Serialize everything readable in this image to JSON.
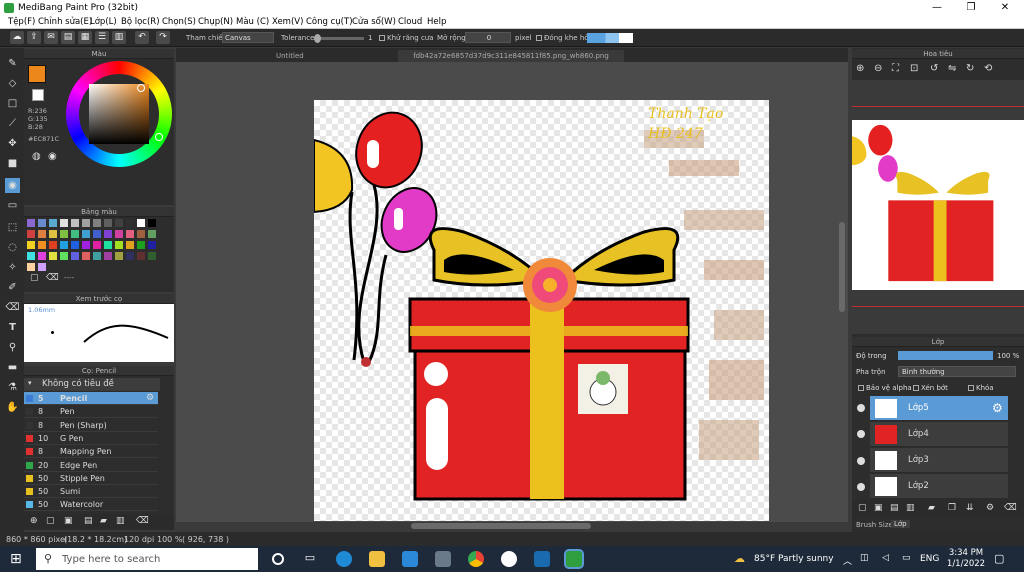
{
  "window": {
    "title": "MediBang Paint Pro (32bit)",
    "minimize": "—",
    "maximize": "❐",
    "close": "✕"
  },
  "menu": [
    "Tệp(F)",
    "Chỉnh sửa(E)",
    "Lớp(L)",
    "Bộ lọc(R)",
    "Chọn(S)",
    "Chụp(N)",
    "Màu (C)",
    "Xem(V)",
    "Công cụ(T)",
    "Cửa sổ(W)",
    "Cloud",
    "Help"
  ],
  "toolbar": {
    "ref_label": "Tham chiếu",
    "ref_value": "Canvas",
    "tolerance_label": "Tolerance",
    "tolerance_value": "1",
    "antialias_label": "Khử răng cưa",
    "expand_label": "Mở rộng",
    "expand_value": "0",
    "expand_unit": "pixel",
    "close_gap_label": "Đóng khe hở"
  },
  "tabs": {
    "untitled": "Untitled",
    "file": "fdb42a72e6857d37d9c311e845811f85.png_wh860.png"
  },
  "color_panel": {
    "title": "Màu",
    "r": "R:236",
    "g": "G:135",
    "b": "B:28",
    "hex": "#EC871C",
    "fg": "#ec871c",
    "bg": "#ffffff"
  },
  "palette_panel": {
    "title": "Bảng màu",
    "more": "----"
  },
  "brush_preview": {
    "title": "Xem trước cọ",
    "size": "1.06mm"
  },
  "brush_panel": {
    "title": "Cọ: Pencil",
    "group": "Không có tiêu đề",
    "brushes": [
      {
        "size": "5",
        "name": "Pencil",
        "color": "#3a7bd5"
      },
      {
        "size": "8",
        "name": "Pen",
        "color": "#333333"
      },
      {
        "size": "8",
        "name": "Pen (Sharp)",
        "color": "#333333"
      },
      {
        "size": "10",
        "name": "G Pen",
        "color": "#e03030"
      },
      {
        "size": "8",
        "name": "Mapping Pen",
        "color": "#e03030"
      },
      {
        "size": "20",
        "name": "Edge Pen",
        "color": "#2ea84a"
      },
      {
        "size": "50",
        "name": "Stipple Pen",
        "color": "#e8c020"
      },
      {
        "size": "50",
        "name": "Sumi",
        "color": "#e8c020"
      },
      {
        "size": "50",
        "name": "Watercolor",
        "color": "#58b8e8"
      }
    ]
  },
  "canvas_text": {
    "signature_line1": "Thanh Tạo",
    "signature_line2": "HĐ 247"
  },
  "navigator": {
    "title": "Hoa tiêu"
  },
  "layer_panel": {
    "title": "Lớp",
    "opacity_label": "Độ trong",
    "opacity_value": "100 %",
    "opacity": 1.0,
    "blend_label": "Pha trộn",
    "blend_value": "Bình thường",
    "protect_alpha": "Bảo vệ alpha",
    "clip": "Xén bớt",
    "lock": "Khóa",
    "layers": [
      {
        "name": "Lớp5"
      },
      {
        "name": "Lớp4"
      },
      {
        "name": "Lớp3"
      },
      {
        "name": "Lớp2"
      }
    ],
    "tab_brush_size": "Brush Size",
    "tab_layer": "Lớp"
  },
  "status": {
    "dims": "860 * 860 pixel",
    "cm": "(18.2 * 18.2cm)",
    "dpi": "120 dpi",
    "zoom": "100 %",
    "coords": "( 926, 738 )"
  },
  "taskbar": {
    "search": "Type here to search",
    "weather": "85°F  Partly sunny",
    "lang": "ENG",
    "time": "3:34 PM",
    "date": "1/1/2022"
  }
}
